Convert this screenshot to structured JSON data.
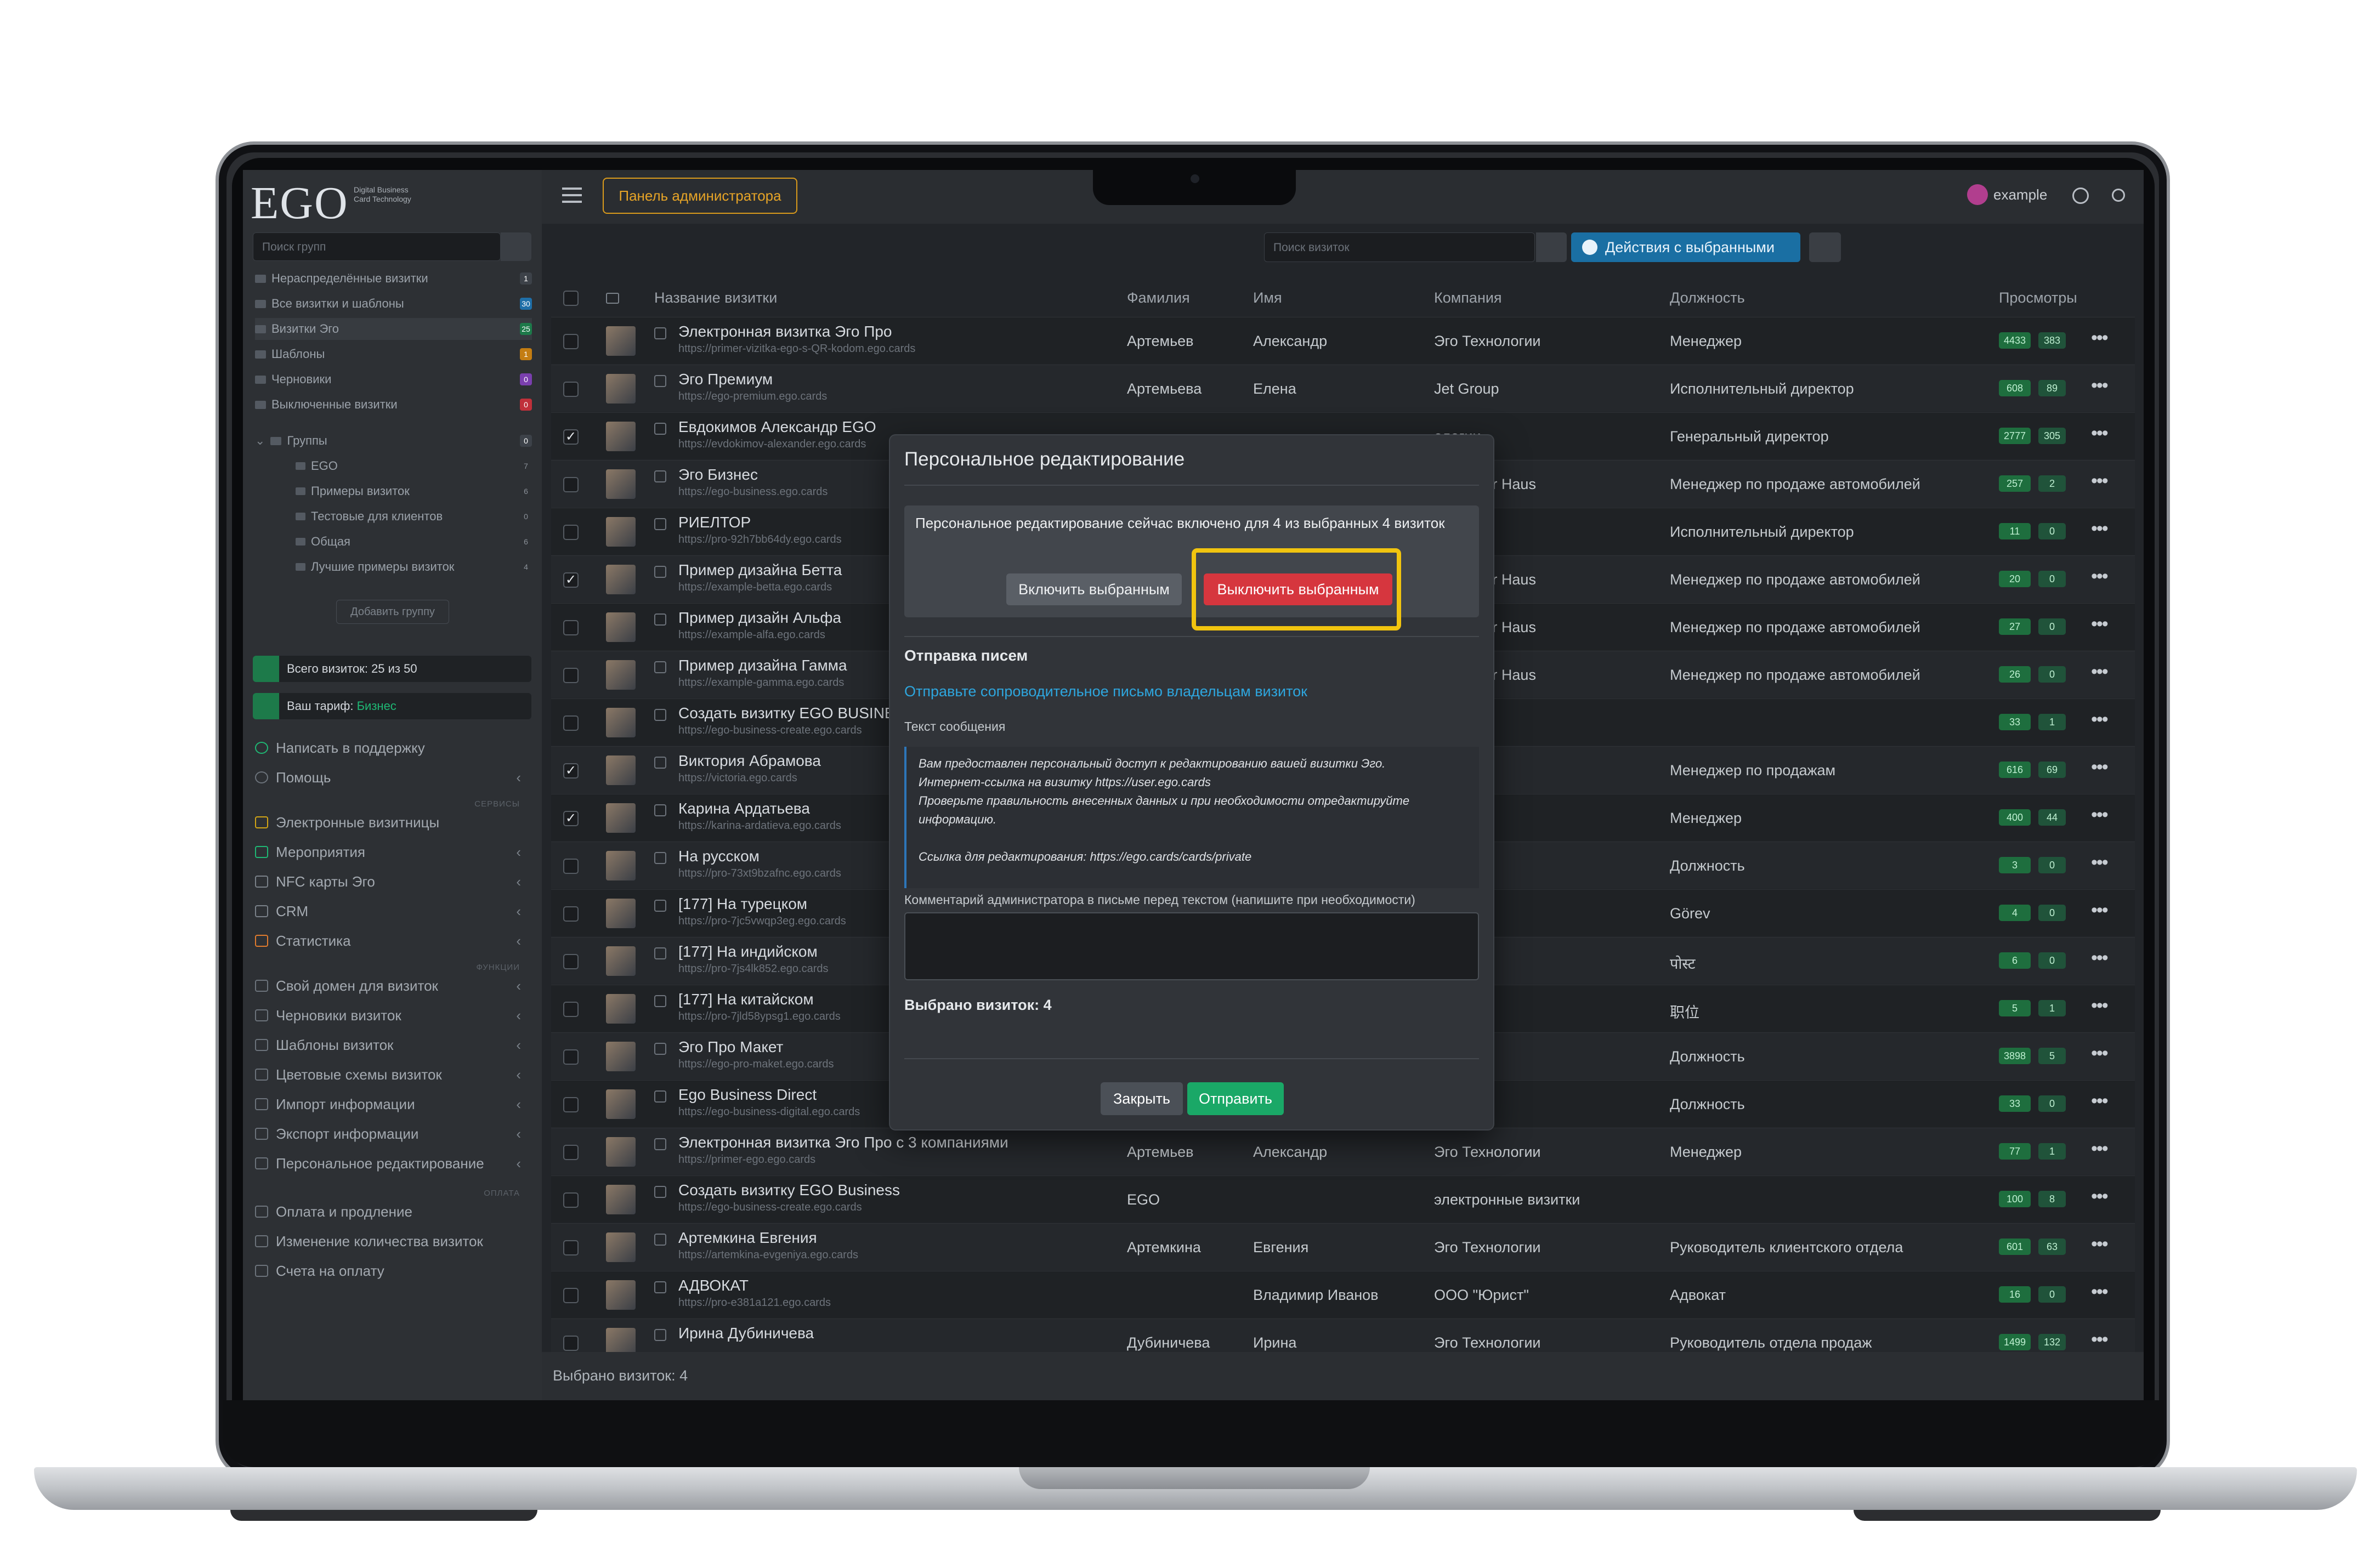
{
  "brand": {
    "logo": "EGO",
    "tagline": "Digital Business Card Technology"
  },
  "topbar": {
    "admin_panel": "Панель администратора",
    "user": "example"
  },
  "sidebar": {
    "search_placeholder": "Поиск групп",
    "folders": [
      {
        "label": "Нераспределённые визитки",
        "count": "1",
        "color": "#3d4249"
      },
      {
        "label": "Все визитки и шаблоны",
        "count": "30",
        "color": "#1f6fa8"
      },
      {
        "label": "Визитки Эго",
        "count": "25",
        "color": "#1d7a4a"
      },
      {
        "label": "Шаблоны",
        "count": "1",
        "color": "#c47d12"
      },
      {
        "label": "Черновики",
        "count": "0",
        "color": "#7a3fae"
      },
      {
        "label": "Выключенные визитки",
        "count": "0",
        "color": "#c0303a"
      }
    ],
    "groups_label": "Группы",
    "groups_count": "0",
    "subgroups": [
      {
        "label": "EGO",
        "count": "7"
      },
      {
        "label": "Примеры визиток",
        "count": "6"
      },
      {
        "label": "Тестовые для клиентов",
        "count": "0"
      },
      {
        "label": "Общая",
        "count": "6"
      },
      {
        "label": "Лучшие примеры визиток",
        "count": "4"
      }
    ],
    "add_group": "Добавить группу",
    "total_cards": "Всего визиток: 25 из 50",
    "tariff_prefix": "Ваш тариф:",
    "tariff_value": "Бизнес",
    "support": "Написать в поддержку",
    "help": "Помощь",
    "section_services": "СЕРВИСЫ",
    "services": [
      "Электронные визитницы",
      "Мероприятия",
      "NFC карты Эго",
      "CRM",
      "Статистика"
    ],
    "section_functions": "ФУНКЦИИ",
    "functions": [
      "Свой домен для визиток",
      "Черновики визиток",
      "Шаблоны визиток",
      "Цветовые схемы визиток",
      "Импорт информации",
      "Экспорт информации",
      "Персональное редактирование"
    ],
    "section_payment": "ОПЛАТА",
    "payment": [
      "Оплата и продление",
      "Изменение количества визиток",
      "Счета на оплату"
    ]
  },
  "toolbar": {
    "search_placeholder": "Поиск визиток",
    "actions": "Действия с выбранными"
  },
  "table": {
    "headers": {
      "name": "Название визитки",
      "surname": "Фамилия",
      "first": "Имя",
      "company": "Компания",
      "position": "Должность",
      "views": "Просмотры"
    },
    "rows": [
      {
        "checked": false,
        "title": "Электронная визитка Эго Про",
        "url": "https://primer-vizitka-ego-s-QR-kodom.ego.cards",
        "surname": "Артемьев",
        "first": "Александр",
        "company": "Эго Технологии",
        "position": "Менеджер",
        "v1": "4433",
        "v2": "383"
      },
      {
        "checked": false,
        "title": "Эго Премиум",
        "url": "https://ego-premium.ego.cards",
        "surname": "Артемьева",
        "first": "Елена",
        "company": "Jet Group",
        "position": "Исполнительный директор",
        "v1": "608",
        "v2": "89"
      },
      {
        "checked": true,
        "title": "Евдокимов Александр EGO",
        "url": "https://evdokimov-alexander.ego.cards",
        "surname": "",
        "first": "",
        "company": "ологии",
        "position": "Генеральный директор",
        "v1": "2777",
        "v2": "305"
      },
      {
        "checked": false,
        "title": "Эго Бизнес",
        "url": "https://ego-business.ego.cards",
        "surname": "",
        "first": "",
        "company": "н Bimmer Haus",
        "position": "Менеджер по продаже автомобилей",
        "v1": "257",
        "v2": "2"
      },
      {
        "checked": false,
        "title": "РИЕЛТОР",
        "url": "https://pro-92h7bb64dy.ego.cards",
        "surname": "",
        "first": "",
        "company": "",
        "position": "Исполнительный директор",
        "v1": "11",
        "v2": "0"
      },
      {
        "checked": true,
        "title": "Пример дизайна Бетта",
        "url": "https://example-betta.ego.cards",
        "surname": "",
        "first": "",
        "company": "н Bimmer Haus",
        "position": "Менеджер по продаже автомобилей",
        "v1": "20",
        "v2": "0"
      },
      {
        "checked": false,
        "title": "Пример дизайн Альфа",
        "url": "https://example-alfa.ego.cards",
        "surname": "",
        "first": "",
        "company": "н Bimmer Haus",
        "position": "Менеджер по продаже автомобилей",
        "v1": "27",
        "v2": "0"
      },
      {
        "checked": false,
        "title": "Пример дизайна Гамма",
        "url": "https://example-gamma.ego.cards",
        "surname": "",
        "first": "",
        "company": "н Bimmer Haus",
        "position": "Менеджер по продаже автомобилей",
        "v1": "26",
        "v2": "0"
      },
      {
        "checked": false,
        "title": "Создать визитку EGO BUSINESS",
        "url": "https://ego-business-create.ego.cards",
        "surname": "",
        "first": "",
        "company": "ологии",
        "position": "",
        "v1": "33",
        "v2": "1"
      },
      {
        "checked": true,
        "title": "Виктория Абрамова",
        "url": "https://victoria.ego.cards",
        "surname": "",
        "first": "",
        "company": "нологии\"",
        "position": "Менеджер по продажам",
        "v1": "616",
        "v2": "69"
      },
      {
        "checked": true,
        "title": "Карина Ардатьева",
        "url": "https://karina-ardatieva.ego.cards",
        "surname": "",
        "first": "",
        "company": "ологии",
        "position": "Менеджер",
        "v1": "400",
        "v2": "44"
      },
      {
        "checked": false,
        "title": "На русском",
        "url": "https://pro-73xt9bzafnc.ego.cards",
        "surname": "",
        "first": "",
        "company": "я",
        "position": "Должность",
        "v1": "3",
        "v2": "0"
      },
      {
        "checked": false,
        "title": "[177] На турецком",
        "url": "https://pro-7jc5vwqp3eg.ego.cards",
        "surname": "",
        "first": "",
        "company": "",
        "position": "Görev",
        "v1": "4",
        "v2": "0"
      },
      {
        "checked": false,
        "title": "[177] На индийском",
        "url": "https://pro-7js4lk852.ego.cards",
        "surname": "",
        "first": "",
        "company": "",
        "position": "पोस्ट",
        "v1": "6",
        "v2": "0"
      },
      {
        "checked": false,
        "title": "[177] На китайском",
        "url": "https://pro-7jld58ypsg1.ego.cards",
        "surname": "",
        "first": "",
        "company": "",
        "position": "职位",
        "v1": "5",
        "v2": "1"
      },
      {
        "checked": false,
        "title": "Эго Про Макет",
        "url": "https://ego-pro-maket.ego.cards",
        "surname": "",
        "first": "",
        "company": "я",
        "position": "Должность",
        "v1": "3898",
        "v2": "5"
      },
      {
        "checked": false,
        "title": "Ego Business Direct",
        "url": "https://ego-business-digital.ego.cards",
        "surname": "",
        "first": "",
        "company": "я",
        "position": "Должность",
        "v1": "33",
        "v2": "0"
      },
      {
        "checked": false,
        "title": "Электронная визитка Эго Про с 3 компаниями",
        "url": "https://primer-ego.ego.cards",
        "surname": "Артемьев",
        "first": "Александр",
        "company": "Эго Технологии",
        "position": "Менеджер",
        "v1": "77",
        "v2": "1"
      },
      {
        "checked": false,
        "title": "Создать визитку EGO Business",
        "url": "https://ego-business-create.ego.cards",
        "surname": "EGO",
        "first": "",
        "company": "электронные визитки",
        "position": "",
        "v1": "100",
        "v2": "8"
      },
      {
        "checked": false,
        "title": "Артемкина Евгения",
        "url": "https://artemkina-evgeniya.ego.cards",
        "surname": "Артемкина",
        "first": "Евгения",
        "company": "Эго Технологии",
        "position": "Руководитель клиентского отдела",
        "v1": "601",
        "v2": "63"
      },
      {
        "checked": false,
        "title": "АДВОКАТ",
        "url": "https://pro-e381a121.ego.cards",
        "surname": "",
        "first": "Владимир Иванов",
        "company": "ООО \"Юрист\"",
        "position": "Адвокат",
        "v1": "16",
        "v2": "0"
      },
      {
        "checked": false,
        "title": "Ирина Дубиничева",
        "url": "",
        "surname": "Дубиничева",
        "first": "Ирина",
        "company": "Эго Технологии",
        "position": "Руководитель отдела продаж",
        "v1": "1499",
        "v2": "132"
      }
    ]
  },
  "footer": {
    "selected": "Выбрано визиток: 4"
  },
  "modal": {
    "title": "Персональное редактирование",
    "alert": "Персональное редактирование сейчас включено для 4 из выбранных 4 визиток",
    "enable": "Включить выбранным",
    "disable": "Выключить выбранным",
    "mail_heading": "Отправка писем",
    "mail_link": "Отправьте сопроводительное письмо владельцам визиток",
    "text_label": "Текст сообщения",
    "message_lines": [
      "Вам предоставлен персональный доступ к редактированию вашей визитки Эго.",
      "Интернет-ссылка на визитку https://user.ego.cards",
      "Проверьте правильность внесенных данных и при необходимости отредактируйте информацию.",
      "",
      "Ссылка для редактирования: https://ego.cards/cards/private"
    ],
    "comment_label": "Комментарий администратора в письме перед текстом (напишите при необходимости)",
    "selected": "Выбрано визиток: 4",
    "close": "Закрыть",
    "send": "Отправить"
  }
}
